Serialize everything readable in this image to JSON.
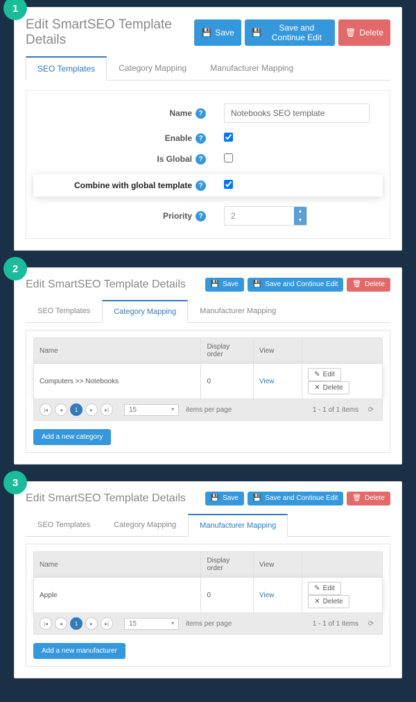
{
  "badges": [
    "1",
    "2",
    "3"
  ],
  "buttons": {
    "save": "Save",
    "saveContinue": "Save and Continue Edit",
    "delete": "Delete"
  },
  "pageTitle": "Edit SmartSEO Template Details",
  "tabs": {
    "seo": "SEO Templates",
    "category": "Category Mapping",
    "manufacturer": "Manufacturer Mapping"
  },
  "panel1": {
    "fields": {
      "name": {
        "label": "Name",
        "value": "Notebooks SEO template"
      },
      "enable": {
        "label": "Enable",
        "checked": true
      },
      "isGlobal": {
        "label": "Is Global",
        "checked": false
      },
      "combine": {
        "label": "Combine with global template",
        "checked": true
      },
      "priority": {
        "label": "Priority",
        "value": "2"
      }
    }
  },
  "grid": {
    "headers": {
      "name": "Name",
      "displayOrder": "Display order",
      "view": "View"
    },
    "actions": {
      "edit": "Edit",
      "del": "Delete",
      "view": "View"
    },
    "pager": {
      "pageSize": "15",
      "itemsPerPage": "items per page",
      "summary": "1 - 1 of 1 items"
    }
  },
  "panel2": {
    "row": {
      "name": "Computers >> Notebooks",
      "displayOrder": "0"
    },
    "addButton": "Add a new category"
  },
  "panel3": {
    "row": {
      "name": "Apple",
      "displayOrder": "0"
    },
    "addButton": "Add a new manufacturer"
  }
}
